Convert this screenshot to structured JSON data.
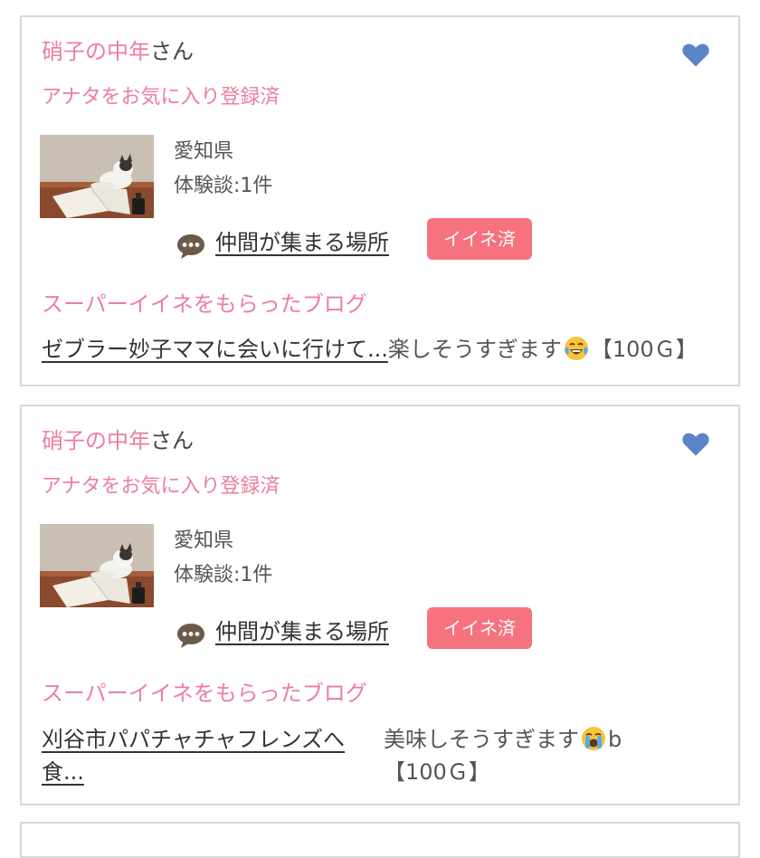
{
  "cards": [
    {
      "user_name": "硝子の中年",
      "user_suffix": "さん",
      "favorite_status": "アナタをお気に入り登録済",
      "prefecture": "愛知県",
      "experience_count": "体験談:1件",
      "place_link": "仲間が集まる場所",
      "iine_badge": "イイネ済",
      "super_title": "スーパーイイネをもらったブログ",
      "blog_title": "ゼブラー妙子ママに会いに行けて...",
      "comment_text": "楽しそうすぎます",
      "comment_suffix": "",
      "points": "【100Ｇ】",
      "emoji": "tears-of-joy-emoji"
    },
    {
      "user_name": "硝子の中年",
      "user_suffix": "さん",
      "favorite_status": "アナタをお気に入り登録済",
      "prefecture": "愛知県",
      "experience_count": "体験談:1件",
      "place_link": "仲間が集まる場所",
      "iine_badge": "イイネ済",
      "super_title": "スーパーイイネをもらったブログ",
      "blog_title": "刈谷市パパチャチャフレンズへ食...",
      "comment_text": "美味しそうすぎます",
      "comment_suffix": "b",
      "points": "【100Ｇ】",
      "emoji": "crying-emoji"
    }
  ],
  "colors": {
    "accent_pink": "#ec7f9c",
    "badge_pink": "#f7727f",
    "heart_blue": "#5b84c8",
    "border": "#d8d8d8"
  },
  "icons": {
    "heart": "heart-icon",
    "chat": "speech-bubble-icon"
  }
}
